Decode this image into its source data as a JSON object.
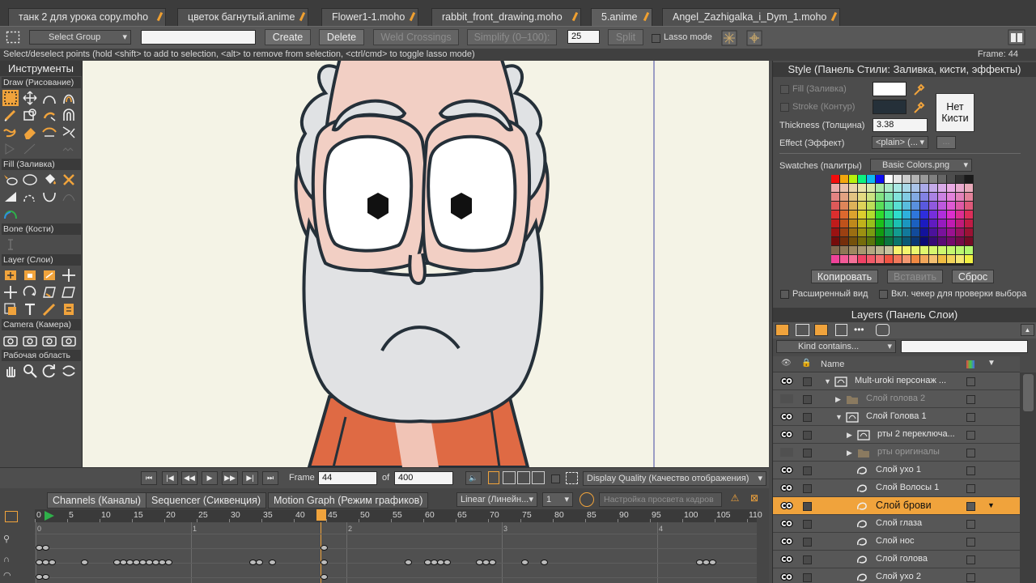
{
  "tabs": [
    {
      "label": "танк 2 для урока copy.moho",
      "active": false
    },
    {
      "label": "цветок багнутый.anime",
      "active": false
    },
    {
      "label": "Flower1-1.moho",
      "active": false
    },
    {
      "label": "rabbit_front_drawing.moho",
      "active": false
    },
    {
      "label": "5.anime",
      "active": true
    },
    {
      "label": "Angel_Zazhigalka_i_Dym_1.moho",
      "active": false
    }
  ],
  "toolbar": {
    "select_group": "Select Group",
    "name_value": "",
    "create": "Create",
    "delete": "Delete",
    "weld_crossings": "Weld Crossings",
    "simplify": "Simplify (0–100):",
    "simplify_value": "25",
    "split": "Split",
    "lasso_mode": "Lasso mode"
  },
  "status": {
    "hint": "Select/deselect points (hold <shift> to add to selection, <alt> to remove from selection, <ctrl/cmd> to toggle lasso mode)",
    "frame": "Frame: 44"
  },
  "tools": {
    "title": "Инструменты",
    "sections": {
      "draw": "Draw (Рисование)",
      "fill": "Fill (Заливка)",
      "bone": "Bone (Кости)",
      "layer": "Layer (Слои)",
      "camera": "Camera (Камера)",
      "workspace": "Рабочая область"
    }
  },
  "style": {
    "title": "Style (Панель Стили: Заливка, кисти, эффекты)",
    "fill_label": "Fill (Заливка)",
    "stroke_label": "Stroke (Контур)",
    "fill_color": "#ffffff",
    "stroke_color": "#253039",
    "brush_button_line1": "Нет",
    "brush_button_line2": "Кисти",
    "thickness_label": "Thickness (Толщина)",
    "thickness_value": "3.38",
    "effect_label": "Effect (Эффект)",
    "effect_value": "<plain> (...",
    "effect_more": "...",
    "swatches_label": "Swatches (палитры)",
    "swatches_value": "Basic Colors.png",
    "copy": "Копировать",
    "paste": "Вставить",
    "reset": "Сброс",
    "advanced_view": "Расширенный вид",
    "checker": "Вкл. чекер для проверки выбора"
  },
  "layers": {
    "title": "Layers (Панель Слои)",
    "kind_contains": "Kind contains...",
    "search_value": "",
    "name_header": "Name",
    "rows": [
      {
        "name": "Mult-uroki персонаж ...",
        "indent": 0,
        "expand": "down",
        "visible": true,
        "kind": "group",
        "selected": false,
        "dim": false
      },
      {
        "name": "Слой голова 2",
        "indent": 1,
        "expand": "right",
        "visible": false,
        "kind": "folder",
        "selected": false,
        "dim": true
      },
      {
        "name": "Слой Голова 1",
        "indent": 1,
        "expand": "down",
        "visible": true,
        "kind": "group",
        "selected": false,
        "dim": false
      },
      {
        "name": "рты 2 переключа...",
        "indent": 2,
        "expand": "right",
        "visible": true,
        "kind": "switch",
        "selected": false,
        "dim": false
      },
      {
        "name": "рты оригиналы",
        "indent": 2,
        "expand": "right",
        "visible": false,
        "kind": "folder",
        "selected": false,
        "dim": true
      },
      {
        "name": "Слой ухо 1",
        "indent": 3,
        "expand": "",
        "visible": true,
        "kind": "vector",
        "selected": false,
        "dim": false
      },
      {
        "name": "Слой Волосы 1",
        "indent": 3,
        "expand": "",
        "visible": true,
        "kind": "vector",
        "selected": false,
        "dim": false
      },
      {
        "name": "Слой брови",
        "indent": 3,
        "expand": "",
        "visible": true,
        "kind": "vector",
        "selected": true,
        "dim": false
      },
      {
        "name": "Слой глаза",
        "indent": 3,
        "expand": "",
        "visible": true,
        "kind": "vector",
        "selected": false,
        "dim": false
      },
      {
        "name": "Слой нос",
        "indent": 3,
        "expand": "",
        "visible": true,
        "kind": "vector",
        "selected": false,
        "dim": false
      },
      {
        "name": "Слой голова",
        "indent": 3,
        "expand": "",
        "visible": true,
        "kind": "vector",
        "selected": false,
        "dim": false
      },
      {
        "name": "Слой ухо 2",
        "indent": 3,
        "expand": "",
        "visible": true,
        "kind": "vector",
        "selected": false,
        "dim": false
      }
    ]
  },
  "transport": {
    "frame_label": "Frame",
    "frame_value": "44",
    "of_label": "of",
    "total_value": "400",
    "display_quality": "Display Quality (Качество отображения)"
  },
  "timeline": {
    "tabs": [
      "Channels (Каналы)",
      "Sequencer (Сиквенция)",
      "Motion Graph (Режим графиков)"
    ],
    "interpolation": "Linear (Линейн...",
    "interp_count": "1",
    "onion_label": "Настройка просвета кадров",
    "current_frame": 44,
    "ruler": [
      "0",
      "5",
      "10",
      "15",
      "20",
      "25",
      "30",
      "35",
      "40",
      "45",
      "50",
      "55",
      "60",
      "65",
      "70",
      "75",
      "80",
      "85",
      "90",
      "95",
      "100",
      "105",
      "110"
    ],
    "seconds": [
      "0",
      "1",
      "2",
      "3",
      "4"
    ]
  }
}
